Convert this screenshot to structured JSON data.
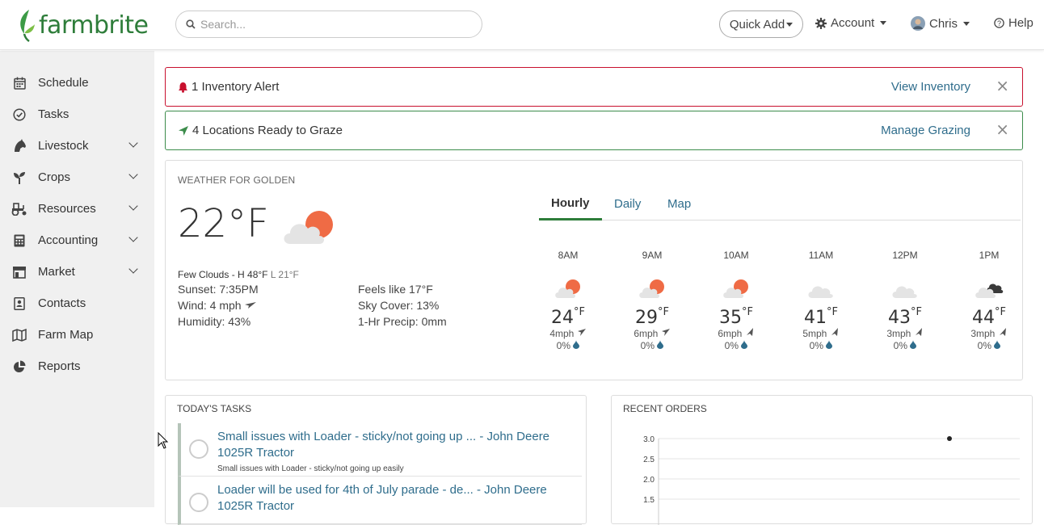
{
  "header": {
    "brand": "farmbrite",
    "search_placeholder": "Search...",
    "quick_add": "Quick Add",
    "account": "Account",
    "user": "Chris",
    "help": "Help"
  },
  "sidebar": {
    "items": [
      {
        "label": "Schedule",
        "icon": "calendar-icon",
        "expandable": false
      },
      {
        "label": "Tasks",
        "icon": "check-circle-icon",
        "expandable": false
      },
      {
        "label": "Livestock",
        "icon": "horse-head-icon",
        "expandable": true
      },
      {
        "label": "Crops",
        "icon": "seedling-icon",
        "expandable": true
      },
      {
        "label": "Resources",
        "icon": "tractor-icon",
        "expandable": true
      },
      {
        "label": "Accounting",
        "icon": "calculator-icon",
        "expandable": true
      },
      {
        "label": "Market",
        "icon": "store-icon",
        "expandable": true
      },
      {
        "label": "Contacts",
        "icon": "address-book-icon",
        "expandable": false
      },
      {
        "label": "Farm Map",
        "icon": "map-icon",
        "expandable": false
      },
      {
        "label": "Reports",
        "icon": "pie-chart-icon",
        "expandable": false
      }
    ]
  },
  "alerts": {
    "inventory": {
      "text": "1 Inventory Alert",
      "link": "View Inventory",
      "close": "×"
    },
    "grazing": {
      "text": "4 Locations Ready to Graze",
      "link": "Manage Grazing",
      "close": "×"
    }
  },
  "weather": {
    "title": "WEATHER FOR GOLDEN",
    "temp": "22°F",
    "cond_main": "Few Clouds - H 48°F",
    "cond_low": " L 21°F",
    "sunset": "Sunset: 7:35PM",
    "wind": "Wind: 4 mph",
    "humidity": "Humidity: 43%",
    "feels": "Feels like 17°F",
    "sky": "Sky Cover: 13%",
    "precip": "1-Hr Precip: 0mm",
    "tabs": [
      "Hourly",
      "Daily",
      "Map"
    ],
    "hours": [
      {
        "time": "8AM",
        "temp": "24",
        "wind": "4mph",
        "rain": "0%",
        "icon": "partly-cloudy-sun-icon"
      },
      {
        "time": "9AM",
        "temp": "29",
        "wind": "6mph",
        "rain": "0%",
        "icon": "partly-cloudy-sun-icon"
      },
      {
        "time": "10AM",
        "temp": "35",
        "wind": "6mph",
        "rain": "0%",
        "icon": "partly-cloudy-sun-icon"
      },
      {
        "time": "11AM",
        "temp": "41",
        "wind": "5mph",
        "rain": "0%",
        "icon": "cloud-icon"
      },
      {
        "time": "12PM",
        "temp": "43",
        "wind": "3mph",
        "rain": "0%",
        "icon": "cloud-icon"
      },
      {
        "time": "1PM",
        "temp": "44",
        "wind": "3mph",
        "rain": "0%",
        "icon": "dark-clouds-icon"
      }
    ],
    "unit": "°F"
  },
  "tasks": {
    "title": "TODAY'S TASKS",
    "items": [
      {
        "title": "Small issues with Loader - sticky/not going up ... - John Deere 1025R Tractor",
        "sub": "Small issues with Loader - sticky/not going up easily"
      },
      {
        "title": "Loader will be used for 4th of July parade - de... - John Deere 1025R Tractor",
        "sub": ""
      }
    ]
  },
  "orders": {
    "title": "RECENT ORDERS",
    "chart_data": {
      "type": "scatter",
      "y_ticks": [
        "3.0",
        "2.5",
        "2.0",
        "1.5"
      ],
      "ylim": [
        1.5,
        3.0
      ],
      "points": [
        {
          "y": 3.0
        }
      ]
    }
  }
}
